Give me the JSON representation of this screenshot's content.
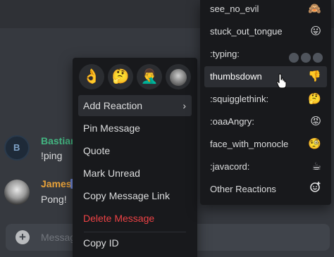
{
  "messages": [
    {
      "author": "Bastian",
      "avatar_letter": "B",
      "text": "!ping",
      "color": "#43b581"
    },
    {
      "author": "James",
      "text": "Pong!",
      "color": "#e8a23a"
    }
  ],
  "input": {
    "placeholder": "Messag"
  },
  "quick_reactions": [
    "👌",
    "🤔",
    "🤦‍♂️",
    "avatar-emoji"
  ],
  "context_menu": {
    "items": [
      {
        "label": "Add Reaction",
        "submenu": true
      },
      {
        "label": "Pin Message"
      },
      {
        "label": "Quote"
      },
      {
        "label": "Mark Unread"
      },
      {
        "label": "Copy Message Link"
      },
      {
        "label": "Delete Message",
        "danger": true
      },
      {
        "label": "Copy ID"
      }
    ]
  },
  "reactions_menu": {
    "items": [
      {
        "label": "see_no_evil",
        "emoji": "🙈"
      },
      {
        "label": "stuck_out_tongue",
        "emoji": "😛"
      },
      {
        "label": ":typing:",
        "emoji": "typing-dots"
      },
      {
        "label": "thumbsdown",
        "emoji": "👎"
      },
      {
        "label": ":squigglethink:",
        "emoji": "🤔"
      },
      {
        "label": ":oaaAngry:",
        "emoji": "😡"
      },
      {
        "label": "face_with_monocle",
        "emoji": "🧐"
      },
      {
        "label": ":javacord:",
        "emoji": "☕"
      },
      {
        "label": "Other Reactions",
        "emoji": "add-reaction-icon"
      }
    ]
  },
  "colors": {
    "background": "#36393f",
    "menu": "#18191c",
    "danger": "#ed4245",
    "accent": "#7289da"
  }
}
